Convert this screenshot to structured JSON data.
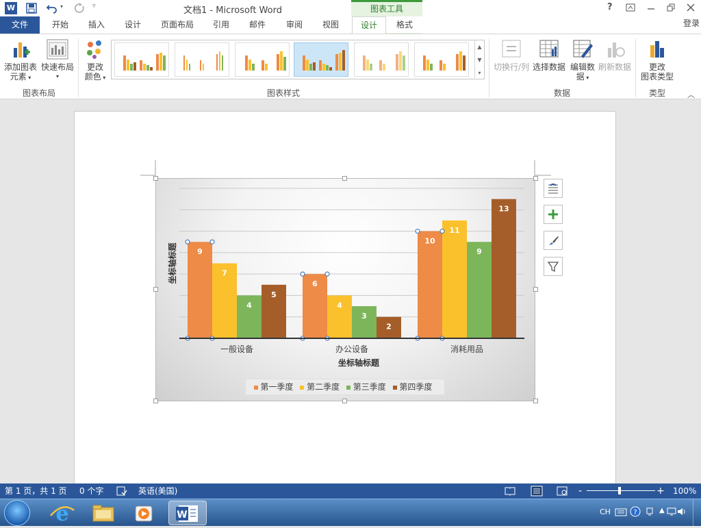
{
  "window": {
    "title": "文档1 - Microsoft Word",
    "context_tab_group": "图表工具",
    "help": "?",
    "sign_in": "登录"
  },
  "tabs": [
    {
      "label": "文件"
    },
    {
      "label": "开始"
    },
    {
      "label": "插入"
    },
    {
      "label": "设计"
    },
    {
      "label": "页面布局"
    },
    {
      "label": "引用"
    },
    {
      "label": "邮件"
    },
    {
      "label": "审阅"
    },
    {
      "label": "视图"
    },
    {
      "label": "设计"
    },
    {
      "label": "格式"
    }
  ],
  "active_tab": "设计",
  "ribbon": {
    "add_element": {
      "line1": "添加图表",
      "line2": "元素"
    },
    "quick_layout": "快速布局",
    "change_colors": {
      "line1": "更改",
      "line2": "颜色"
    },
    "switch_row_col": "切换行/列",
    "select_data": "选择数据",
    "edit_data": {
      "line1": "编辑数",
      "line2": "据"
    },
    "refresh_data": "刷新数据",
    "change_type": {
      "line1": "更改",
      "line2": "图表类型"
    },
    "groups": {
      "chart_layouts": "图表布局",
      "chart_styles": "图表样式",
      "data": "数据",
      "type": "类型"
    }
  },
  "chart_data": {
    "type": "bar",
    "categories": [
      "一般设备",
      "办公设备",
      "消耗用品"
    ],
    "series": [
      {
        "name": "第一季度",
        "values": [
          9,
          6,
          10
        ],
        "color": "#ed8b47"
      },
      {
        "name": "第二季度",
        "values": [
          7,
          4,
          11
        ],
        "color": "#fbc12c"
      },
      {
        "name": "第三季度",
        "values": [
          4,
          3,
          9
        ],
        "color": "#7db55b"
      },
      {
        "name": "第四季度",
        "values": [
          5,
          2,
          13
        ],
        "color": "#a55e2a"
      }
    ],
    "xlabel": "坐标轴标题",
    "ylabel": "坐标轴标题",
    "ylim": [
      0,
      14
    ],
    "grid": true,
    "legend": "bottom"
  },
  "status": {
    "page": "第 1 页，共 1 页",
    "words": "0 个字",
    "language": "英语(美国)",
    "zoom": "100%",
    "minus": "-",
    "plus": "+"
  },
  "taskbar": {
    "ime": "CH"
  }
}
